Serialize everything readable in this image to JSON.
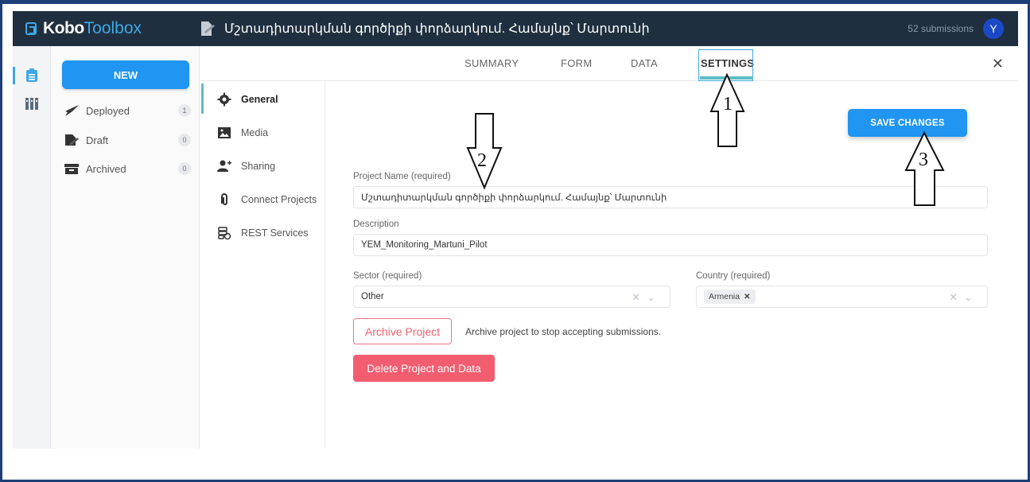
{
  "header": {
    "brand_bold": "Kobo",
    "brand_light": "Toolbox",
    "project_title": "Մշտադիտարկման գործիքի փորձարկում. Համայնք՝ Մարտունի",
    "submissions": "52 submissions",
    "avatar_letter": "Y"
  },
  "sidebar": {
    "new_label": "NEW",
    "items": [
      {
        "label": "Deployed",
        "count": "1",
        "icon": "rocket-icon"
      },
      {
        "label": "Draft",
        "count": "0",
        "icon": "draft-icon"
      },
      {
        "label": "Archived",
        "count": "0",
        "icon": "archive-icon"
      }
    ]
  },
  "tabs": [
    "SUMMARY",
    "FORM",
    "DATA",
    "SETTINGS"
  ],
  "subnav": [
    "General",
    "Media",
    "Sharing",
    "Connect Projects",
    "REST Services"
  ],
  "form": {
    "save_label": "SAVE CHANGES",
    "name_label": "Project Name (required)",
    "name_value": "Մշտադիտարկման գործիքի փորձարկում. Համայնք՝ Մարտունի",
    "description_label": "Description",
    "description_value": "YEM_Monitoring_Martuni_Pilot",
    "sector_label": "Sector (required)",
    "sector_value": "Other",
    "country_label": "Country (required)",
    "country_value": "Armenia",
    "archive_label": "Archive Project",
    "archive_note": "Archive project to stop accepting submissions.",
    "delete_label": "Delete Project and Data"
  },
  "annotations": [
    "1",
    "2",
    "3"
  ],
  "colors": {
    "accent": "#2095f2",
    "topbar": "#1f2f3f",
    "danger": "#f25d6f",
    "tab_highlight": "#5fbbc8"
  }
}
